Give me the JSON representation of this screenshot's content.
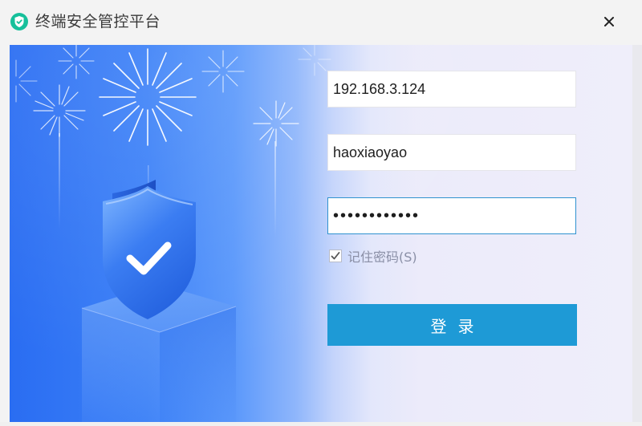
{
  "window": {
    "title": "终端安全管控平台",
    "close_symbol": "×"
  },
  "login_form": {
    "server_address": "192.168.3.124",
    "username": "haoxiaoyao",
    "password_masked": "••••••••••••",
    "remember_password": {
      "label": "记住密码(S)",
      "checked": true
    },
    "login_button_label": "登录"
  },
  "icons": {
    "app": "shield-logo-icon",
    "close": "close-icon",
    "checkbox": "checkmark-icon",
    "illustration": "shield-check-illustration"
  },
  "colors": {
    "login_button": "#1e9ad6",
    "focused_field_border": "#2f92cf",
    "panel_gradient_start": "#2a6df2",
    "panel_gradient_end": "#efeefa",
    "app_icon": "#16c09b"
  }
}
